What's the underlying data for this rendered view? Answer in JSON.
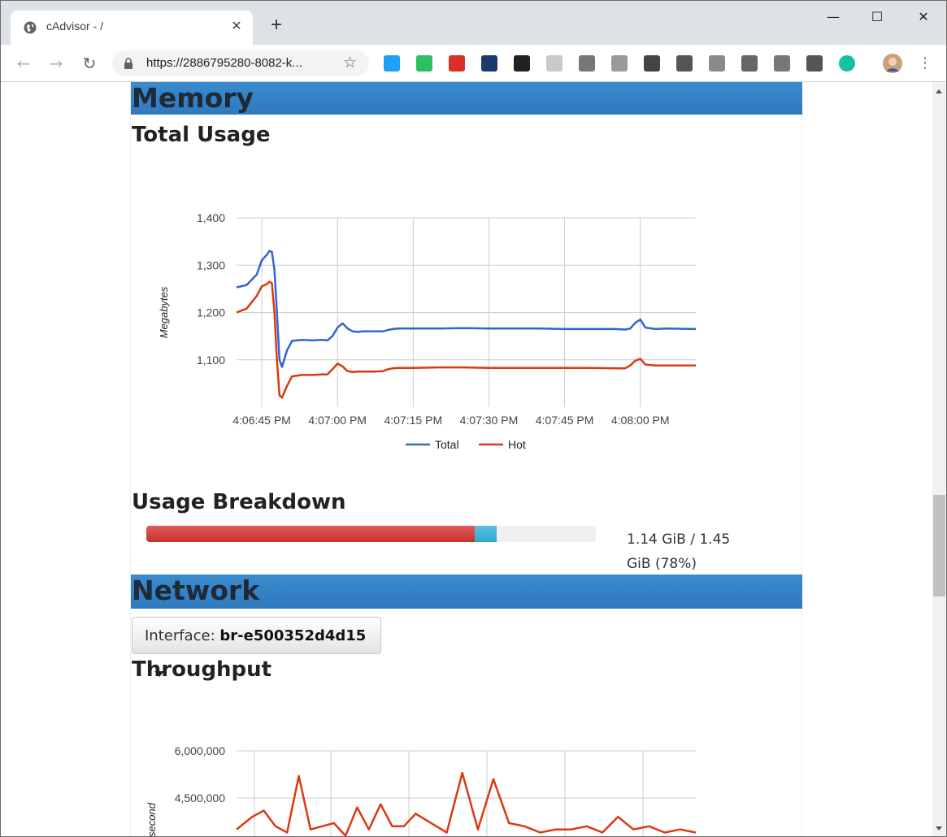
{
  "browser": {
    "tab_title": "cAdvisor - /",
    "tab_close": "✕",
    "new_tab": "+",
    "url": "https://2886795280-8082-k...",
    "minimize": "—",
    "maximize": "☐",
    "close": "✕"
  },
  "extensions": [
    {
      "name": "extension-1",
      "color": "#1da1f2"
    },
    {
      "name": "evernote-icon",
      "color": "#2dbe60"
    },
    {
      "name": "gmail-icon",
      "color": "#d93025"
    },
    {
      "name": "analytics-icon",
      "color": "#1a3b6e"
    },
    {
      "name": "buffer-icon",
      "color": "#222222"
    },
    {
      "name": "extension-6",
      "color": "#c9c9c9"
    },
    {
      "name": "extension-7",
      "color": "#777777"
    },
    {
      "name": "extension-8",
      "color": "#9a9a9a"
    },
    {
      "name": "trello-icon",
      "color": "#444444"
    },
    {
      "name": "extension-10",
      "color": "#555555"
    },
    {
      "name": "drive-icon",
      "color": "#8a8a8a"
    },
    {
      "name": "tag-icon",
      "color": "#666666"
    },
    {
      "name": "extension-13",
      "color": "#777777"
    },
    {
      "name": "extension-14",
      "color": "#555555"
    },
    {
      "name": "grammarly-icon",
      "color": "#15c39a"
    }
  ],
  "memory": {
    "section_title": "Memory",
    "total_usage_title": "Total Usage",
    "usage_breakdown_title": "Usage Breakdown",
    "usage_text": "1.14 GiB / 1.45 GiB (78%)",
    "hot_fraction": 0.73,
    "total_fraction": 0.78
  },
  "network": {
    "section_title": "Network",
    "interface_label": "Interface: ",
    "interface_value": "br-e500352d4d15",
    "throughput_title": "Throughput"
  },
  "chart_data": [
    {
      "type": "line",
      "ylabel": "Megabytes",
      "ylim": [
        1000,
        1400
      ],
      "yticks": [
        1100,
        1200,
        1300,
        1400
      ],
      "ytick_labels": [
        "1,100",
        "1,200",
        "1,300",
        "1,400"
      ],
      "xticks": [
        "4:06:45 PM",
        "4:07:00 PM",
        "4:07:15 PM",
        "4:07:30 PM",
        "4:07:45 PM",
        "4:08:00 PM"
      ],
      "xtick_seconds": [
        0,
        15,
        30,
        45,
        60,
        75
      ],
      "xlim": [
        -5,
        86
      ],
      "grid": true,
      "legend_position": "bottom",
      "series": [
        {
          "name": "Total",
          "color": "#3366cc",
          "x": [
            -5,
            -3,
            -1,
            0,
            1,
            1.5,
            2,
            2.5,
            3,
            3.5,
            4,
            5,
            6,
            8,
            10,
            12,
            13,
            14,
            15,
            16,
            17,
            18,
            19,
            20,
            22,
            24,
            25,
            26,
            27,
            30,
            35,
            40,
            45,
            50,
            55,
            60,
            65,
            70,
            72,
            73,
            74,
            75,
            76,
            78,
            80,
            86
          ],
          "y": [
            1253,
            1258,
            1280,
            1310,
            1322,
            1330,
            1328,
            1290,
            1200,
            1100,
            1085,
            1120,
            1140,
            1142,
            1141,
            1142,
            1141,
            1150,
            1168,
            1177,
            1166,
            1160,
            1159,
            1160,
            1160,
            1160,
            1163,
            1165,
            1166,
            1166,
            1166,
            1167,
            1166,
            1166,
            1166,
            1165,
            1165,
            1165,
            1164,
            1166,
            1178,
            1185,
            1168,
            1165,
            1166,
            1165
          ]
        },
        {
          "name": "Hot",
          "color": "#dc3912",
          "x": [
            -5,
            -3,
            -1,
            0,
            1,
            1.5,
            2,
            2.5,
            3,
            3.5,
            4,
            5,
            6,
            8,
            10,
            12,
            13,
            14,
            15,
            16,
            17,
            18,
            19,
            20,
            22,
            24,
            25,
            26,
            27,
            30,
            35,
            40,
            45,
            50,
            55,
            60,
            65,
            70,
            72,
            73,
            74,
            75,
            76,
            78,
            80,
            86
          ],
          "y": [
            1200,
            1208,
            1235,
            1255,
            1260,
            1265,
            1262,
            1200,
            1100,
            1025,
            1020,
            1045,
            1065,
            1068,
            1068,
            1069,
            1069,
            1080,
            1092,
            1086,
            1076,
            1074,
            1075,
            1075,
            1075,
            1076,
            1080,
            1082,
            1083,
            1083,
            1084,
            1084,
            1083,
            1083,
            1083,
            1083,
            1083,
            1082,
            1082,
            1088,
            1098,
            1102,
            1090,
            1088,
            1088,
            1088
          ]
        }
      ]
    },
    {
      "type": "line",
      "ylabel": "second",
      "yticks": [
        4500000,
        6000000
      ],
      "ytick_labels": [
        "4,500,000",
        "6,000,000"
      ],
      "grid": true,
      "series": [
        {
          "name": "",
          "color": "#dc3912",
          "x": [
            0,
            4,
            7,
            10,
            13,
            16,
            19,
            22,
            25,
            28,
            31,
            34,
            37,
            40,
            43,
            46,
            50,
            54,
            58,
            62,
            66,
            70,
            74,
            78,
            82,
            86,
            90,
            94,
            98,
            102,
            106,
            110,
            114,
            118
          ],
          "y": [
            3500000,
            3900000,
            4100000,
            3600000,
            3400000,
            5200000,
            3500000,
            3600000,
            3700000,
            3300000,
            4200000,
            3500000,
            4300000,
            3600000,
            3600000,
            4000000,
            3700000,
            3400000,
            5300000,
            3500000,
            5100000,
            3700000,
            3600000,
            3400000,
            3500000,
            3500000,
            3600000,
            3400000,
            3900000,
            3500000,
            3600000,
            3400000,
            3500000,
            3400000
          ]
        }
      ]
    }
  ]
}
